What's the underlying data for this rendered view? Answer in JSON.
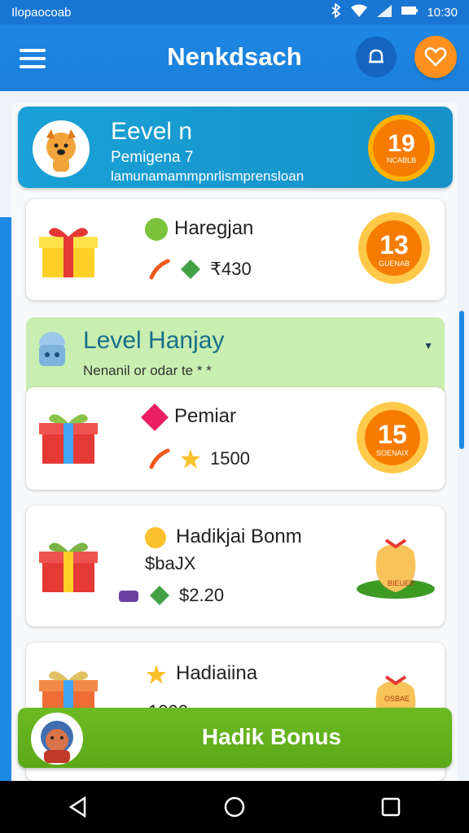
{
  "status": {
    "carrier": "Ilopaocoab",
    "time": "10:30"
  },
  "app": {
    "title": "Nenkdsach"
  },
  "level_card": {
    "title": "Eevel n",
    "subtitle": "Pemigena 7",
    "description": "lamunamammpnrlismprensloan",
    "badge_number": "19",
    "badge_label": "NCABLB"
  },
  "rewards": [
    {
      "title": "Haregjan",
      "value": "430",
      "value_prefix": "₹",
      "badge_number": "13",
      "badge_label": "GUENAB"
    }
  ],
  "section": {
    "title": "Level Hanjay",
    "subtitle": "Nenanil or odar te",
    "stars": "* *"
  },
  "rewards2": [
    {
      "title": "Pemiar",
      "value": "1500",
      "badge_number": "15",
      "badge_label": "SOENAIX"
    },
    {
      "title": "Hadikjai Bonm",
      "subvalue": "$baJX",
      "value": "$2.20",
      "bag_label": "BIEUEB"
    },
    {
      "title": "Hadiaiina",
      "value": "1000",
      "bag_label": "OSBAE"
    }
  ],
  "cta": {
    "label": "Hadik Bonus"
  },
  "colors": {
    "primary": "#1e88e5",
    "accent": "#ff8f1f",
    "green": "#6cba22",
    "badge": "#f57c00"
  }
}
